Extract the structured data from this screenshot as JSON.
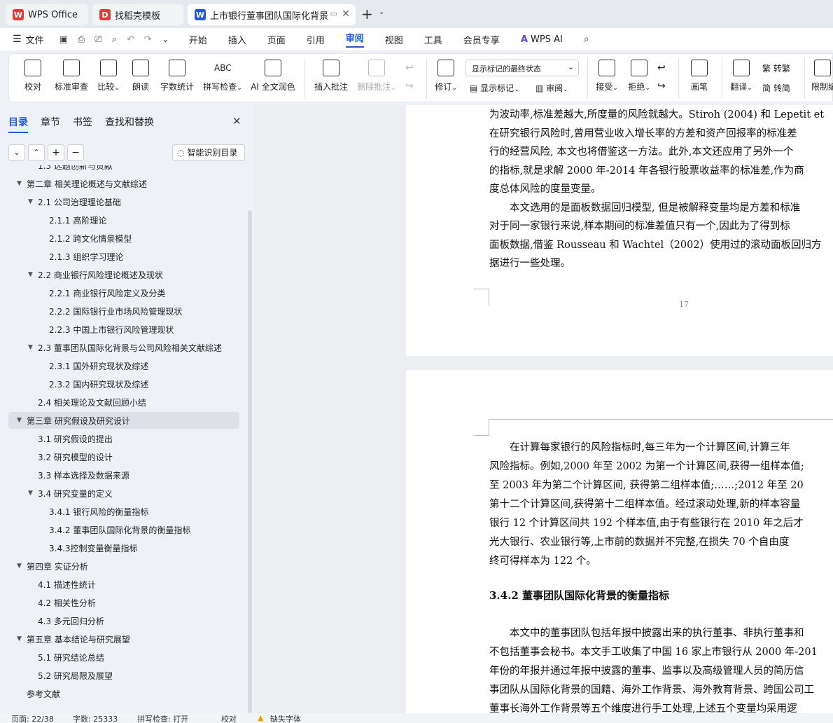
{
  "tabs": [
    {
      "label": "WPS Office",
      "icon": "wps-logo-icon",
      "color": "#e53935"
    },
    {
      "label": "找稻壳模板",
      "icon": "docer-icon",
      "color": "#e53935"
    },
    {
      "label": "上市银行董事团队国际化背景",
      "icon": "word-doc-icon",
      "color": "#1e5bd8"
    }
  ],
  "menu": {
    "file": "文件",
    "items": [
      "开始",
      "插入",
      "页面",
      "引用",
      "审阅",
      "视图",
      "工具",
      "会员专享"
    ],
    "active": "审阅",
    "wps_ai": "WPS AI",
    "accent": "#1e5bd8"
  },
  "ribbon": {
    "proofread": "校对",
    "std_review": "标准审查",
    "compare": "比较",
    "read_aloud": "朗读",
    "word_count": "字数统计",
    "spell_check": "拼写检查",
    "ai_polish": "AI 全文润色",
    "insert_comment": "插入批注",
    "delete_comment": "删除批注",
    "revise": "修订",
    "markup_state": "显示标记的最终状态",
    "show_markup": "显示标记",
    "review_pane": "审阅",
    "accept": "接受",
    "reject": "拒绝",
    "pen": "画笔",
    "translate": "翻译",
    "to_trad": "转繁",
    "to_simp": "转简",
    "restrict": "限制编"
  },
  "sidebar": {
    "tabs": [
      "目录",
      "章节",
      "书签",
      "查找和替换"
    ],
    "smart_toc": "智能识别目录",
    "toc": [
      {
        "label": "1.3 选题创新与贡献",
        "level": 2,
        "tri": false
      },
      {
        "label": "第二章 相关理论概述与文献综述",
        "level": 1,
        "tri": true
      },
      {
        "label": "2.1 公司治理理论基础",
        "level": 2,
        "tri": true
      },
      {
        "label": "2.1.1 高阶理论",
        "level": 3,
        "tri": false
      },
      {
        "label": "2.1.2 跨文化情景模型",
        "level": 3,
        "tri": false
      },
      {
        "label": "2.1.3 组织学习理论",
        "level": 3,
        "tri": false
      },
      {
        "label": "2.2 商业银行风险理论概述及现状",
        "level": 2,
        "tri": true
      },
      {
        "label": "2.2.1 商业银行风险定义及分类",
        "level": 3,
        "tri": false
      },
      {
        "label": "2.2.2 国际银行业市场风险管理现状",
        "level": 3,
        "tri": false
      },
      {
        "label": "2.2.3 中国上市银行风险管理现状",
        "level": 3,
        "tri": false
      },
      {
        "label": "2.3 董事团队国际化背景与公司风险相关文献综述",
        "level": 2,
        "tri": true
      },
      {
        "label": "2.3.1 国外研究现状及综述",
        "level": 3,
        "tri": false
      },
      {
        "label": "2.3.2 国内研究现状及综述",
        "level": 3,
        "tri": false
      },
      {
        "label": "2.4 相关理论及文献回顾小结",
        "level": 2,
        "tri": false
      },
      {
        "label": "第三章 研究假设及研究设计",
        "level": 1,
        "tri": true,
        "selected": true
      },
      {
        "label": "3.1 研究假设的提出",
        "level": 2,
        "tri": false
      },
      {
        "label": "3.2 研究模型的设计",
        "level": 2,
        "tri": false
      },
      {
        "label": "3.3 样本选择及数据来源",
        "level": 2,
        "tri": false
      },
      {
        "label": "3.4 研究变量的定义",
        "level": 2,
        "tri": true
      },
      {
        "label": "3.4.1 银行风险的衡量指标",
        "level": 3,
        "tri": false
      },
      {
        "label": "3.4.2 董事团队国际化背景的衡量指标",
        "level": 3,
        "tri": false
      },
      {
        "label": "3.4.3控制变量衡量指标",
        "level": 3,
        "tri": false
      },
      {
        "label": "第四章 实证分析",
        "level": 1,
        "tri": true
      },
      {
        "label": "4.1 描述性统计",
        "level": 2,
        "tri": false
      },
      {
        "label": "4.2 相关性分析",
        "level": 2,
        "tri": false
      },
      {
        "label": "4.3 多元回归分析",
        "level": 2,
        "tri": false
      },
      {
        "label": "第五章 基本结论与研究展望",
        "level": 1,
        "tri": true
      },
      {
        "label": "5.1 研究结论总结",
        "level": 2,
        "tri": false
      },
      {
        "label": "5.2 研究局限及展望",
        "level": 2,
        "tri": false
      },
      {
        "label": "参考文献",
        "level": 1,
        "tri": false
      }
    ]
  },
  "doc": {
    "page1_lines": [
      "为波动率,标准差越大,所度量的风险就越大。Stiroh (2004) 和 Lepetit et",
      "在研究银行风险时,曾用营业收入增长率的方差和资产回报率的标准差",
      "行的经营风险, 本文也将借鉴这一方法。此外,本文还应用了另外一个",
      "的指标,就是求解 2000 年-2014 年各银行股票收益率的标准差,作为商",
      "度总体风险的度量变量。",
      "　　本文选用的是面板数据回归模型, 但是被解释变量均是方差和标准",
      "对于同一家银行来说,样本期间的标准差值只有一个,因此为了得到标",
      "面板数据,借鉴 Rousseau 和 Wachtel（2002）使用过的滚动面板回归方",
      "据进行一些处理。"
    ],
    "page_number": "17",
    "page2_lines": [
      "　　在计算每家银行的风险指标时,每三年为一个计算区间,计算三年",
      "风险指标。例如,2000 年至 2002 为第一个计算区间,获得一组样本值;",
      "至 2003 年为第二个计算区间, 获得第二组样本值;……;2012 年至 20",
      "第十二个计算区间,获得第十二组样本值。经过滚动处理,新的样本容量",
      "银行 12 个计算区间共 192 个样本值,由于有些银行在 2010 年之后才",
      "光大银行、农业银行等,上市前的数据并不完整,在损失 70 个自由度",
      "终可得样本为 122 个。"
    ],
    "heading": "3.4.2 董事团队国际化背景的衡量指标",
    "page2_lines_b": [
      "　　本文中的董事团队包括年报中披露出来的执行董事、非执行董事和",
      "不包括董事会秘书。本文手工收集了中国 16 家上市银行从 2000 年-201",
      "年份的年报并通过年报中披露的董事、监事以及高级管理人员的简历信",
      "事团队从国际化背景的国籍、海外工作背景、海外教育背景、跨国公司工",
      "董事长海外工作背景等五个维度进行手工处理,上述五个变量均采用逻"
    ]
  },
  "status": {
    "page": "页面: 22/38",
    "words": "字数: 25333",
    "spell": "拼写检查: 打开",
    "proof": "校对",
    "missing_font": "缺失字体"
  }
}
